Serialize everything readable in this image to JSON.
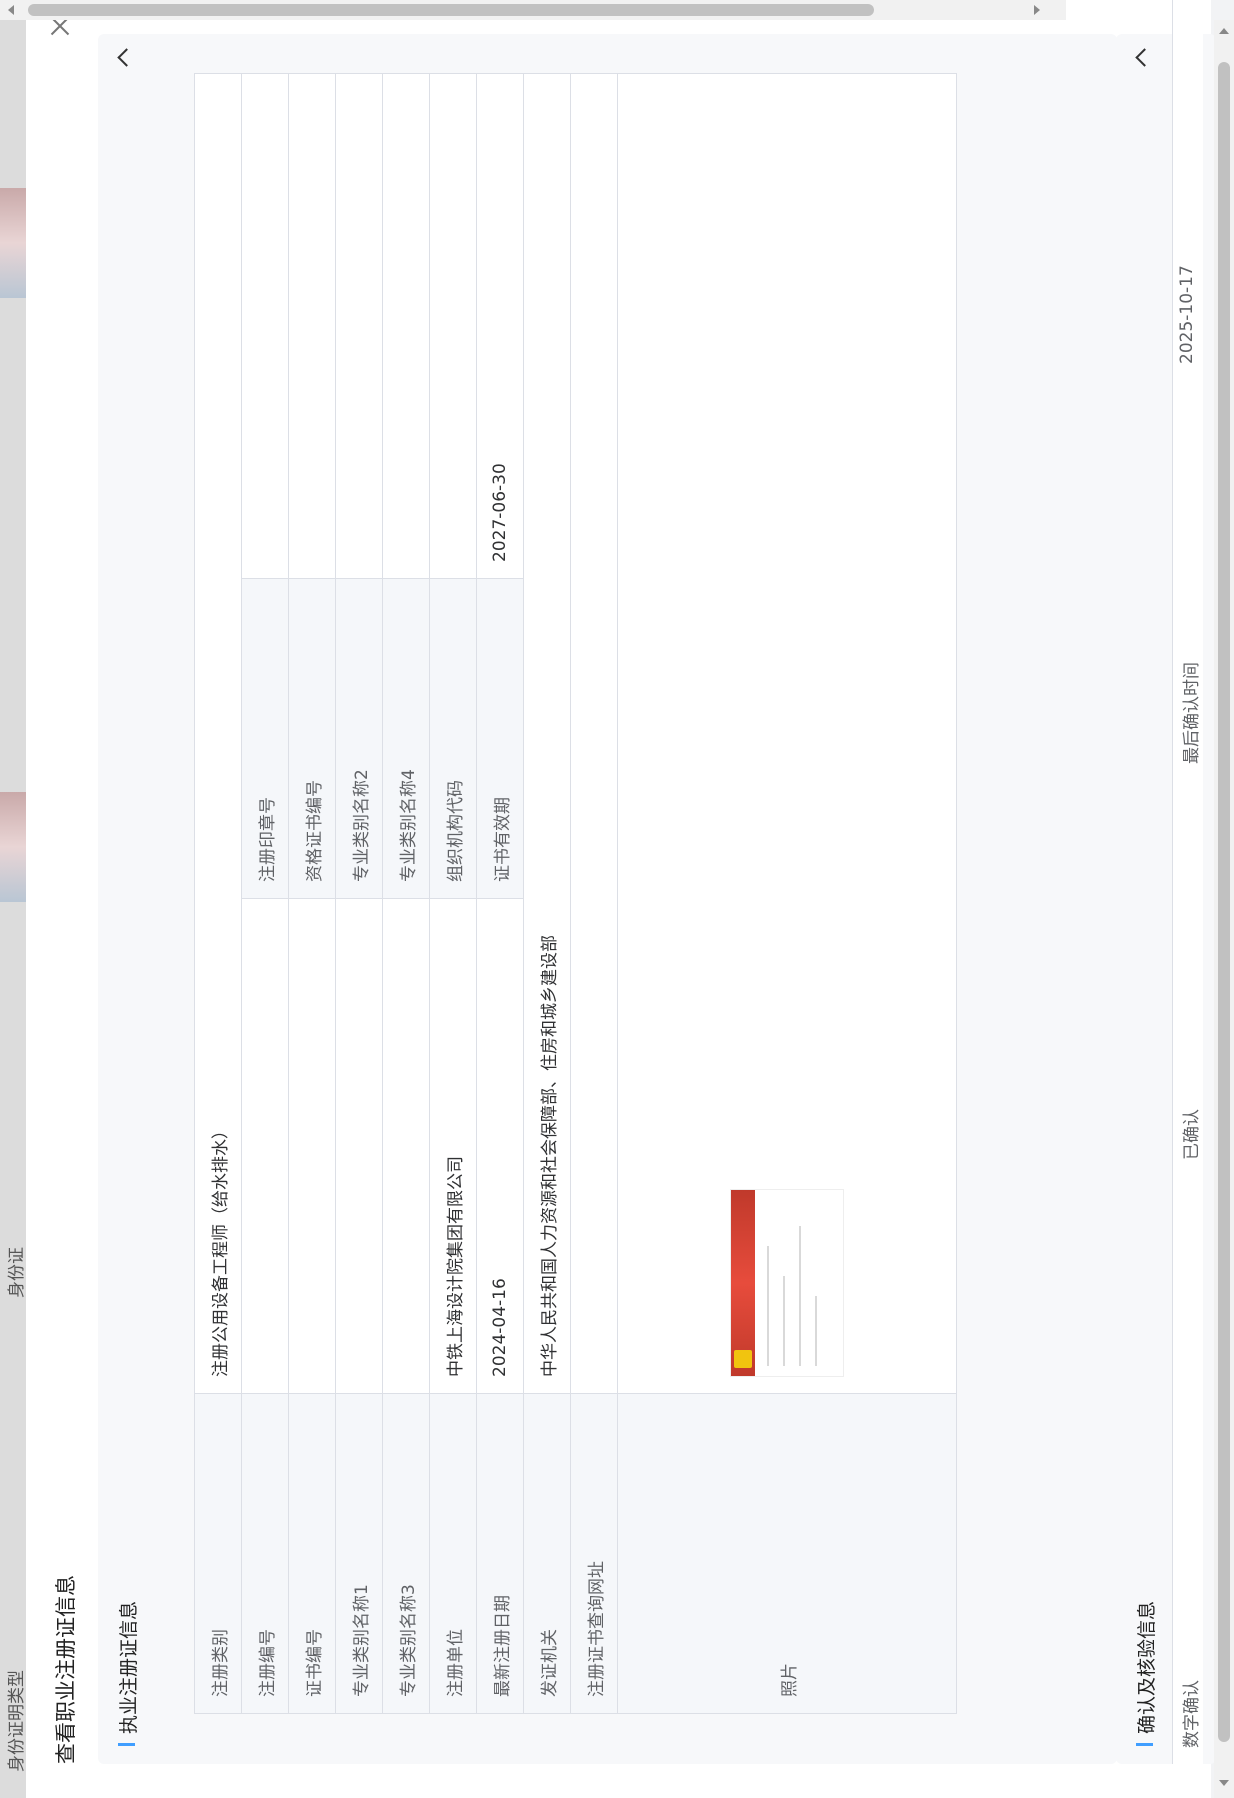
{
  "background": {
    "labels": [
      "身份证明类型",
      "身份证"
    ]
  },
  "dialog": {
    "title": "查看职业注册证信息"
  },
  "registration_section": {
    "title": "执业注册证信息",
    "rows": [
      [
        {
          "label": "注册类别",
          "value": "注册公用设备工程师（给水排水）",
          "span": 3
        }
      ],
      [
        {
          "label": "注册编号",
          "value": ""
        },
        {
          "label": "注册印章号",
          "value": ""
        }
      ],
      [
        {
          "label": "证书编号",
          "value": ""
        },
        {
          "label": "资格证书编号",
          "value": ""
        }
      ],
      [
        {
          "label": "专业类别名称1",
          "value": ""
        },
        {
          "label": "专业类别名称2",
          "value": ""
        }
      ],
      [
        {
          "label": "专业类别名称3",
          "value": ""
        },
        {
          "label": "专业类别名称4",
          "value": ""
        }
      ],
      [
        {
          "label": "注册单位",
          "value": "中铁上海设计院集团有限公司"
        },
        {
          "label": "组织机构代码",
          "value": ""
        }
      ],
      [
        {
          "label": "最新注册日期",
          "value": "2024-04-16"
        },
        {
          "label": "证书有效期",
          "value": "2027-06-30"
        }
      ],
      [
        {
          "label": "发证机关",
          "value": "中华人民共和国人力资源和社会保障部、住房和城乡建设部",
          "span": 3
        }
      ],
      [
        {
          "label": "注册证书查询网址",
          "value": "",
          "span": 3
        }
      ]
    ],
    "photo_label": "照片"
  },
  "confirm_section": {
    "title": "确认及核验信息",
    "cells": [
      "数字确认",
      "已确认",
      "最后确认时间",
      "2025-10-17"
    ]
  },
  "colors": {
    "accent": "#409eff",
    "label_bg": "#f5f7fa",
    "border": "#dcdfe6"
  },
  "icons": [
    "close-icon",
    "chevron-right-icon",
    "scroll-up-icon",
    "scroll-down-icon",
    "scroll-left-icon",
    "scroll-right-icon"
  ]
}
